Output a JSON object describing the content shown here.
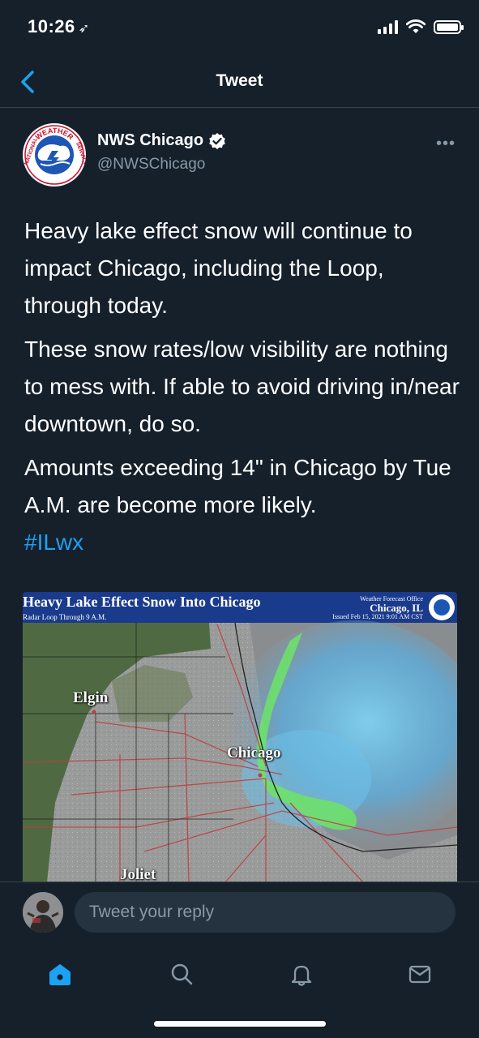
{
  "status_bar": {
    "time": "10:26",
    "location_glyph": "➶"
  },
  "nav": {
    "title": "Tweet"
  },
  "tweet": {
    "author_name": "NWS Chicago",
    "author_handle": "@NWSChicago",
    "verified": true,
    "more_label": "•••",
    "paragraphs": [
      "Heavy lake effect snow will continue to impact Chicago, including the Loop, through today.",
      "These snow rates/low visibility are nothing to mess with. If able to avoid driving in/near downtown, do so.",
      "Amounts exceeding 14\" in Chicago by Tue A.M. are become more likely."
    ],
    "hashtag": "#ILwx",
    "logo_text_top": "WEATHER",
    "logo_text_left": "NATIONAL",
    "logo_text_right": "SERVICE",
    "media": {
      "title": "Heavy Lake Effect Snow Into Chicago",
      "subtitle": "Radar Loop Through 9 A.M.",
      "office_label": "Weather Forecast Office",
      "office_city": "Chicago, IL",
      "issued": "Issued Feb 15, 2021 9:01 AM CST",
      "cities": [
        "Elgin",
        "Chicago",
        "Joliet"
      ]
    }
  },
  "reply": {
    "placeholder": "Tweet your reply"
  },
  "tabs": [
    {
      "name": "home",
      "active": true
    },
    {
      "name": "search",
      "active": false
    },
    {
      "name": "notifications",
      "active": false
    },
    {
      "name": "messages",
      "active": false
    }
  ],
  "colors": {
    "background": "#15202b",
    "accent": "#1da1f2",
    "secondary_text": "#8899a6",
    "divider": "#38444d"
  }
}
